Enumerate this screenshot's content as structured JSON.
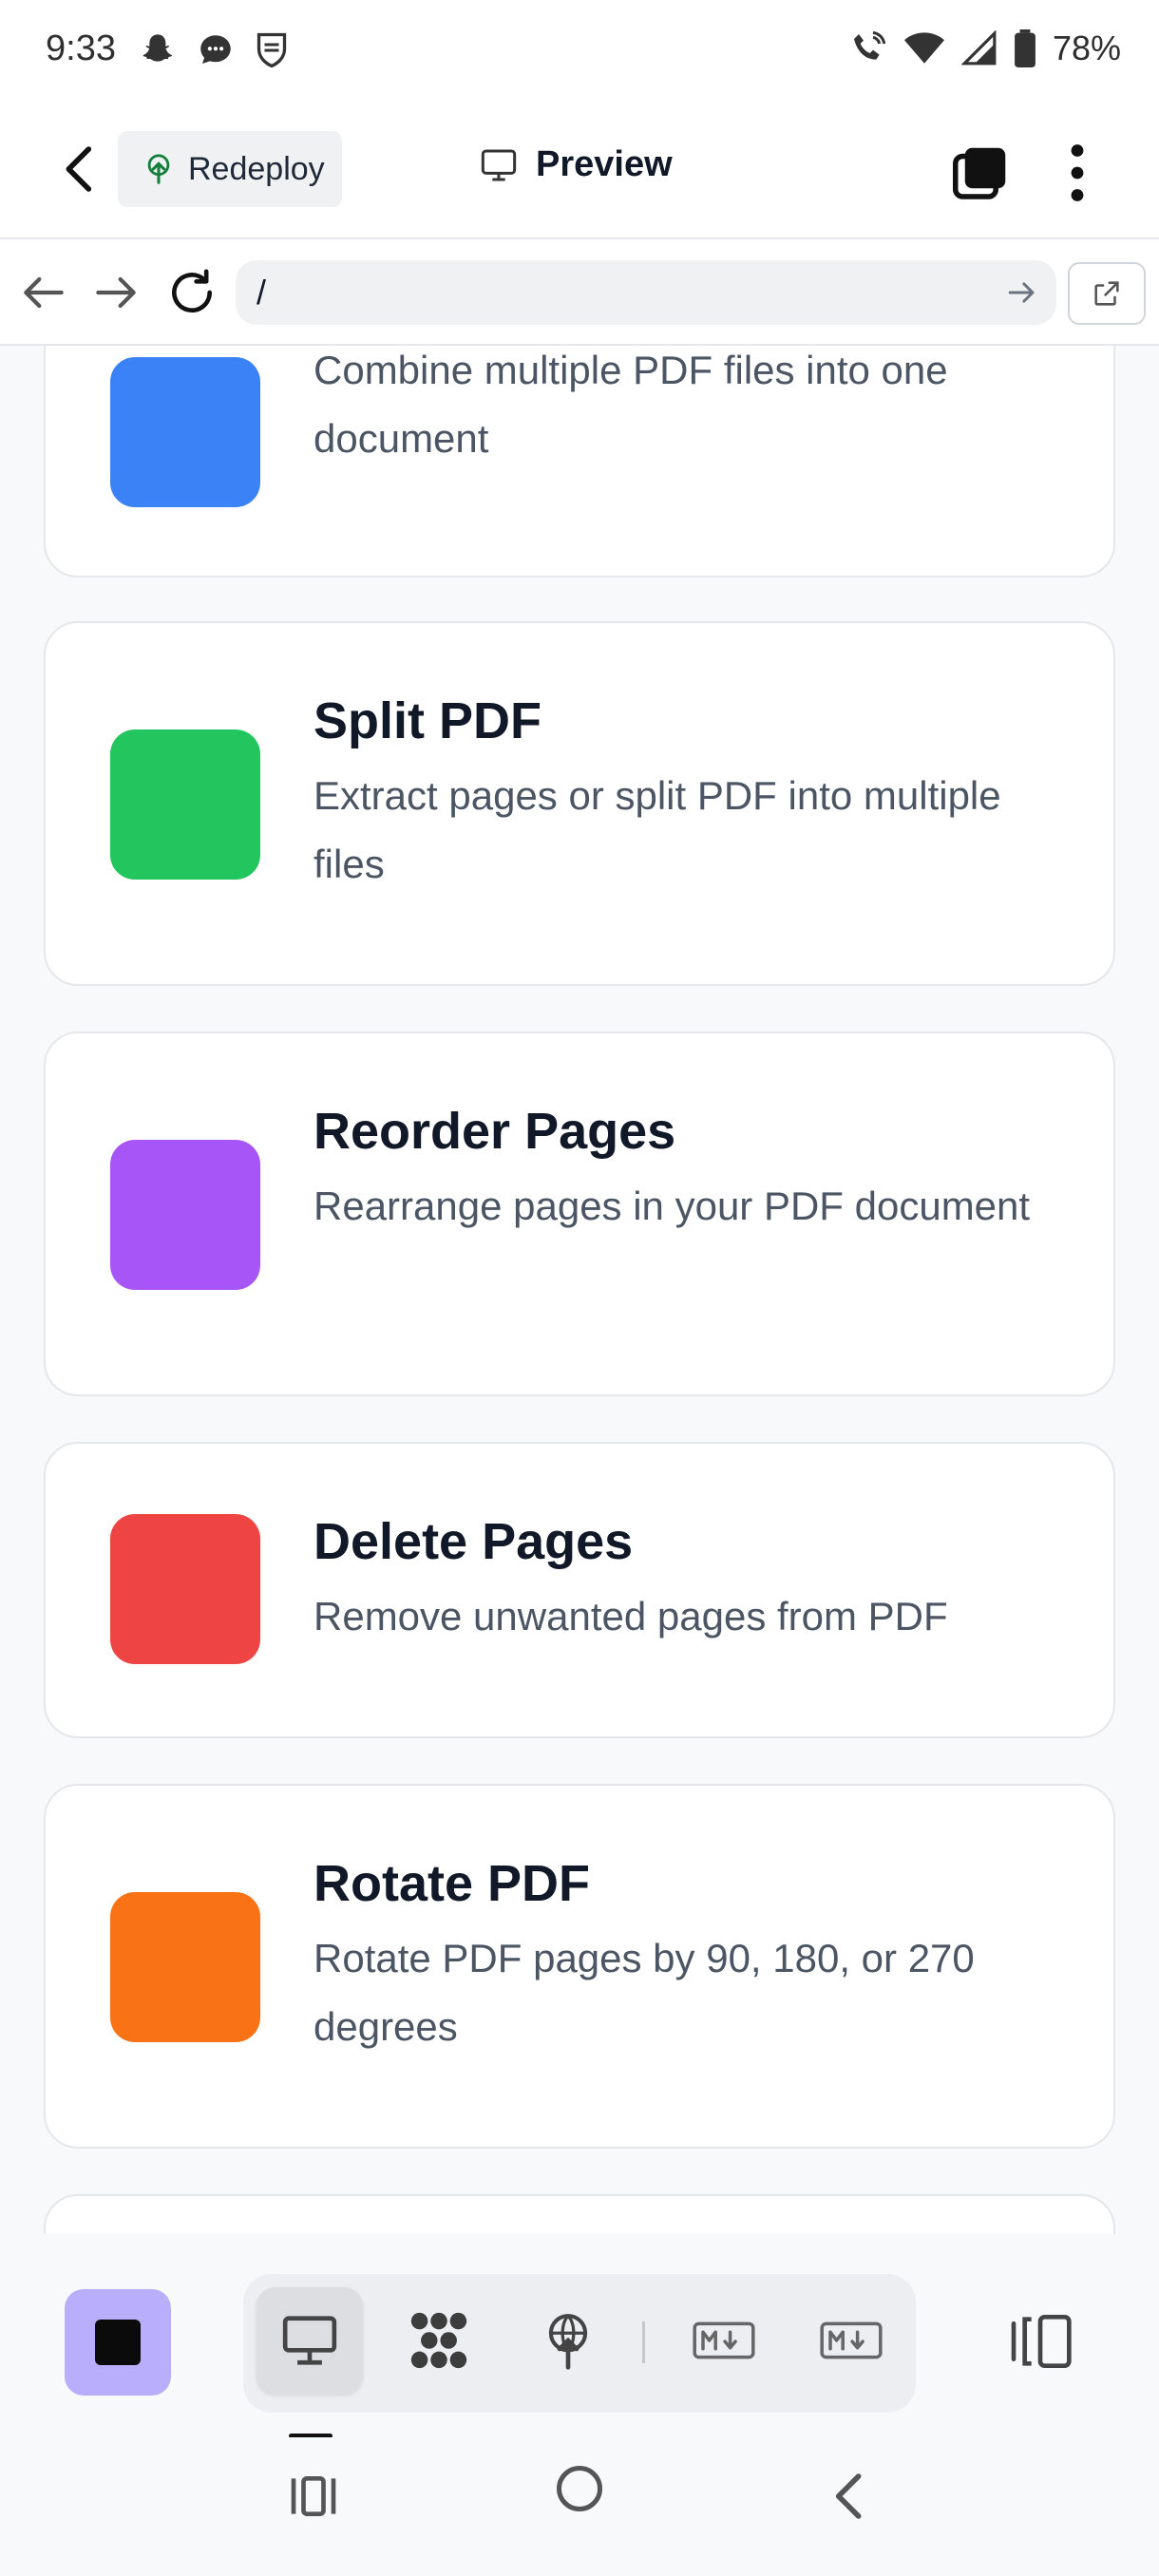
{
  "status_bar": {
    "time": "9:33",
    "battery": "78%",
    "left_icons": [
      "snapchat-icon",
      "messages-icon",
      "shield-icon"
    ],
    "right_icons": [
      "wifi-call-icon",
      "wifi-icon",
      "signal-icon",
      "battery-icon"
    ]
  },
  "app_bar": {
    "redeploy_label": "Redeploy",
    "title": "Preview"
  },
  "address_bar": {
    "url": "/"
  },
  "cards": [
    {
      "title": "",
      "description": "Combine multiple PDF files into one document",
      "color": "#3b82f6"
    },
    {
      "title": "Split PDF",
      "description": "Extract pages or split PDF into multiple files",
      "color": "#22c55e"
    },
    {
      "title": "Reorder Pages",
      "description": "Rearrange pages in your PDF document",
      "color": "#a855f7"
    },
    {
      "title": "Delete Pages",
      "description": "Remove unwanted pages from PDF",
      "color": "#ef4444"
    },
    {
      "title": "Rotate PDF",
      "description": "Rotate PDF pages by 90, 180, or 270 degrees",
      "color": "#f97316"
    }
  ],
  "bottom_toolbar": {
    "stop_color": "#b9aefc",
    "buttons": [
      "desktop-icon",
      "graph-icon",
      "deploy-icon",
      "markdown-icon",
      "markdown-icon"
    ]
  },
  "colors": {
    "accent": "#b9aefc",
    "page_background": "#f8f9fb",
    "card_border": "#e5e7eb"
  }
}
